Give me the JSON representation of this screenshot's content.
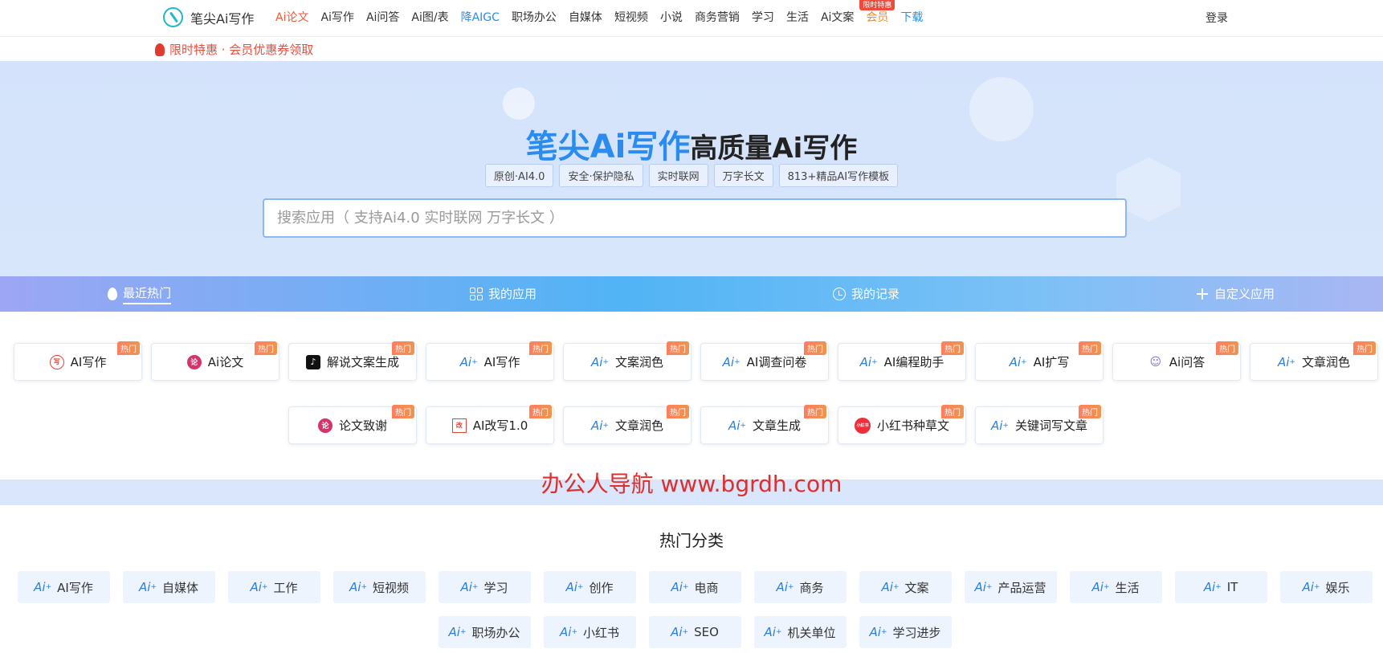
{
  "nav": {
    "logo_text": "笔尖Ai写作",
    "items": [
      {
        "label": "Ai论文",
        "style": "active"
      },
      {
        "label": "Ai写作",
        "style": ""
      },
      {
        "label": "Ai问答",
        "style": ""
      },
      {
        "label": "Ai图/表",
        "style": ""
      },
      {
        "label": "降AIGC",
        "style": "blue"
      },
      {
        "label": "职场办公",
        "style": ""
      },
      {
        "label": "自媒体",
        "style": ""
      },
      {
        "label": "短视频",
        "style": ""
      },
      {
        "label": "小说",
        "style": ""
      },
      {
        "label": "商务营销",
        "style": ""
      },
      {
        "label": "学习",
        "style": ""
      },
      {
        "label": "生活",
        "style": ""
      },
      {
        "label": "Ai文案",
        "style": ""
      },
      {
        "label": "会员",
        "style": "orange",
        "badge": "限时特惠"
      },
      {
        "label": "下载",
        "style": "blue"
      }
    ],
    "login_label": "登录"
  },
  "promo": {
    "text": "限时特惠 · 会员优惠券领取"
  },
  "hero": {
    "title_brand": "笔尖Ai写作",
    "title_rest": "高质量Ai写作",
    "tags": [
      "原创·AI4.0",
      "安全·保护隐私",
      "实时联网",
      "万字长文",
      "813+精品AI写作模板"
    ],
    "search_placeholder": "搜索应用（ 支持Ai4.0 实时联网 万字长文 ）"
  },
  "tabs": [
    {
      "label": "最近热门",
      "icon": "flame-icon",
      "active": true
    },
    {
      "label": "我的应用",
      "icon": "grid-icon",
      "active": false
    },
    {
      "label": "我的记录",
      "icon": "clock-icon",
      "active": false
    },
    {
      "label": "自定义应用",
      "icon": "plus-icon",
      "active": false
    }
  ],
  "hot_badge": "热门",
  "apps_row1": [
    {
      "label": "AI写作",
      "icon": "essay-stamp-icon"
    },
    {
      "label": "Ai论文",
      "icon": "paper-icon"
    },
    {
      "label": "解说文案生成",
      "icon": "tiktok-icon"
    },
    {
      "label": "AI写作",
      "icon": "ai-icon"
    },
    {
      "label": "文案润色",
      "icon": "ai-icon"
    },
    {
      "label": "AI调查问卷",
      "icon": "ai-icon"
    },
    {
      "label": "AI编程助手",
      "icon": "ai-icon"
    },
    {
      "label": "AI扩写",
      "icon": "ai-icon"
    },
    {
      "label": "Ai问答",
      "icon": "robot-icon"
    },
    {
      "label": "文章润色",
      "icon": "ai-icon"
    }
  ],
  "apps_row2": [
    {
      "label": "论文致谢",
      "icon": "paper-icon"
    },
    {
      "label": "AI改写1.0",
      "icon": "rewrite-icon"
    },
    {
      "label": "文章润色",
      "icon": "ai-icon"
    },
    {
      "label": "文章生成",
      "icon": "ai-icon"
    },
    {
      "label": "小红书种草文",
      "icon": "xiaohongshu-icon"
    },
    {
      "label": "关键词写文章",
      "icon": "ai-icon"
    }
  ],
  "watermark": "办公人导航 www.bgrdh.com",
  "categories_title": "热门分类",
  "categories_row1": [
    "AI写作",
    "自媒体",
    "工作",
    "短视频",
    "学习",
    "创作",
    "电商",
    "商务",
    "文案",
    "产品运营",
    "生活",
    "IT",
    "娱乐"
  ],
  "categories_row2": [
    "职场办公",
    "小红书",
    "SEO",
    "机关单位",
    "学习进步"
  ],
  "ai_mark": "Ai",
  "colors": {
    "brand_blue": "#2a8cf0",
    "active_red": "#ef5a3c",
    "watermark_red": "#e02d2d",
    "hot_orange": "#ff7e5f"
  }
}
